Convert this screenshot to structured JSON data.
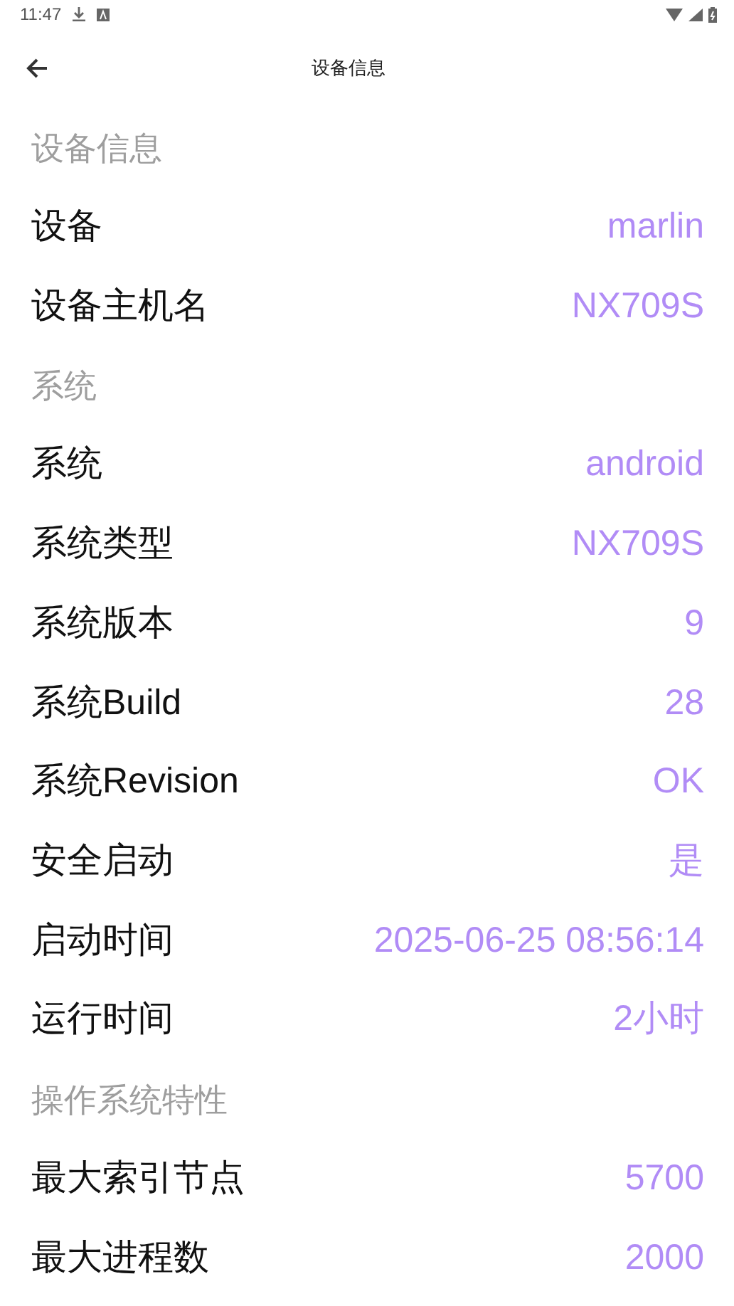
{
  "status_bar": {
    "time": "11:47"
  },
  "app_bar": {
    "title": "设备信息"
  },
  "sections": [
    {
      "title": "设备信息",
      "items": [
        {
          "label": "设备",
          "value": "marlin"
        },
        {
          "label": "设备主机名",
          "value": "NX709S"
        }
      ]
    },
    {
      "title": "系统",
      "items": [
        {
          "label": "系统",
          "value": "android"
        },
        {
          "label": "系统类型",
          "value": "NX709S"
        },
        {
          "label": "系统版本",
          "value": "9"
        },
        {
          "label": "系统Build",
          "value": "28"
        },
        {
          "label": "系统Revision",
          "value": "OK"
        },
        {
          "label": "安全启动",
          "value": "是"
        },
        {
          "label": "启动时间",
          "value": "2025-06-25 08:56:14"
        },
        {
          "label": "运行时间",
          "value": "2小时"
        }
      ]
    },
    {
      "title": "操作系统特性",
      "items": [
        {
          "label": "最大索引节点",
          "value": "5700"
        },
        {
          "label": "最大进程数",
          "value": "2000"
        }
      ]
    }
  ]
}
